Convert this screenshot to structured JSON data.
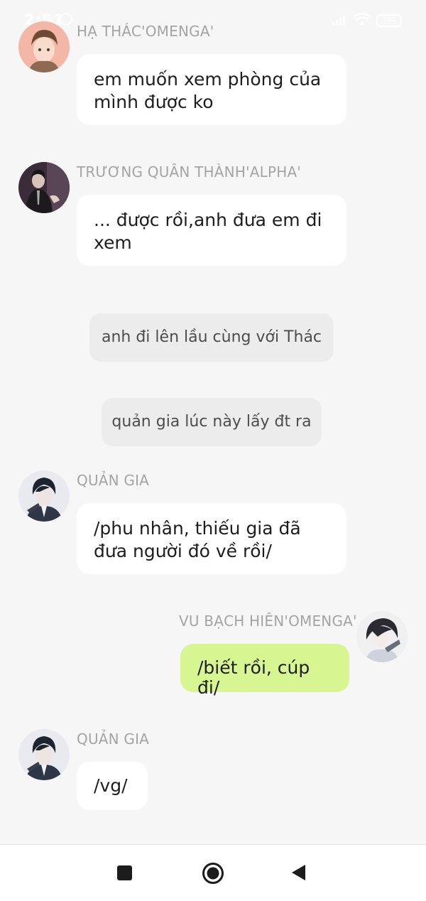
{
  "status_bar": {
    "time": "2:51",
    "battery": "100",
    "colors": {
      "foreground": "#ffffff"
    }
  },
  "messages": [
    {
      "sender": "HẠ THÁC'OMENGA'",
      "text": "em muốn xem phòng của mình được ko",
      "avatar": "avatar-ha-thac",
      "side": "left"
    },
    {
      "sender": "TRƯƠNG QUÂN THÀNH'ALPHA'",
      "text": "... được rồi,anh đưa em đi xem",
      "avatar": "avatar-truong-quan-thanh",
      "side": "left"
    },
    {
      "sender": "QUẢN GIA",
      "text": "/phu nhân, thiếu gia đã đưa người đó về rồi/",
      "avatar": "avatar-quan-gia",
      "side": "left"
    },
    {
      "sender": "VU BẠCH HIÊN'OMENGA'",
      "text": "/biết rồi, cúp đi/",
      "avatar": "avatar-vu-bach-hien",
      "side": "right"
    },
    {
      "sender": "QUẢN GIA",
      "text": "/vg/",
      "avatar": "avatar-quan-gia",
      "side": "left"
    }
  ],
  "narrations": [
    "anh đi lên lầu cùng với Thác",
    "quản gia lúc này lấy đt ra"
  ],
  "nav_bar": {
    "icons": [
      "recents-icon",
      "home-icon",
      "back-icon"
    ]
  },
  "colors": {
    "background": "#f6f6f6",
    "bubble_other": "#ffffff",
    "bubble_self": "#d7f591",
    "narration": "#ececec",
    "sender_name": "#a4a4a4"
  }
}
